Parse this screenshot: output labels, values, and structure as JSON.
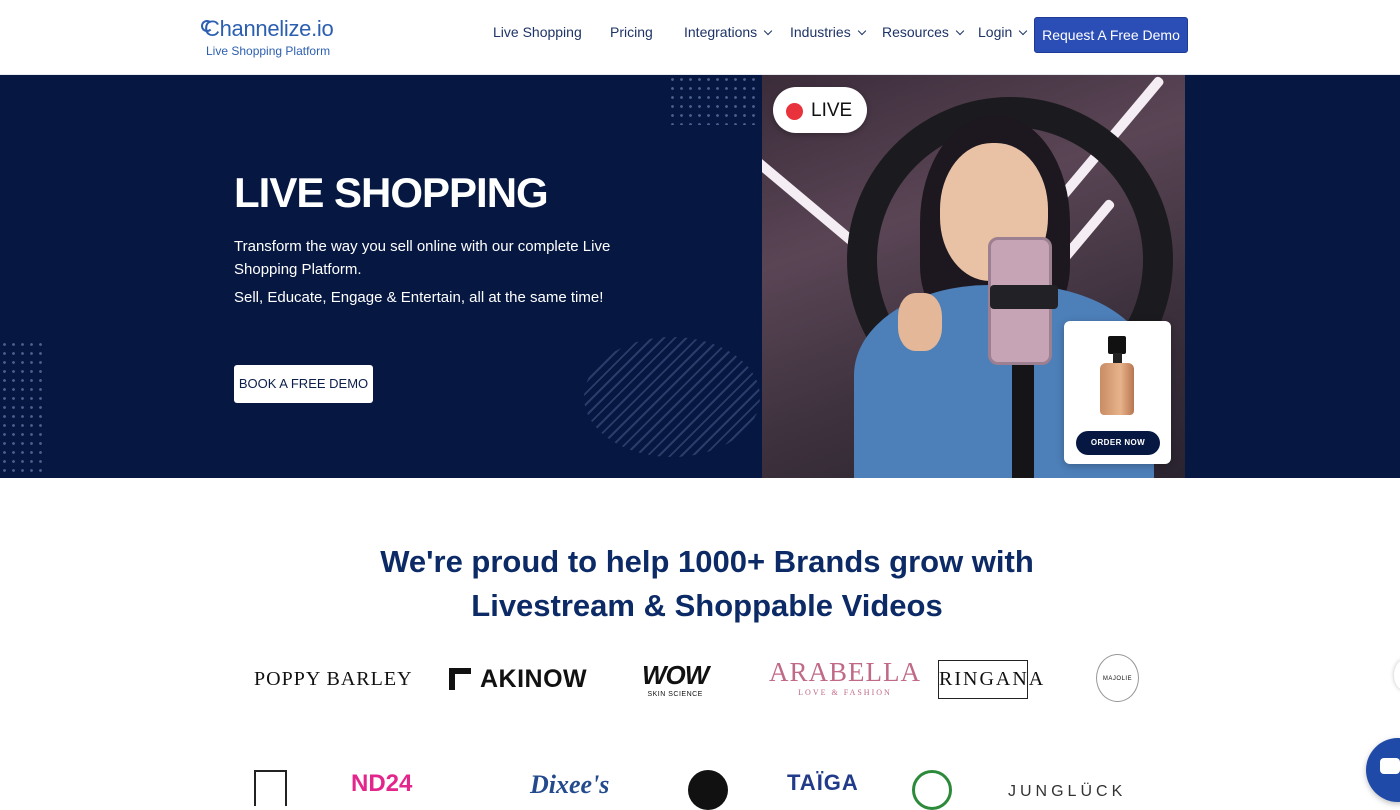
{
  "logo": {
    "name": "Channelize.io",
    "tagline": "Live Shopping Platform"
  },
  "nav": {
    "items": [
      {
        "label": "Live Shopping",
        "has_dropdown": false
      },
      {
        "label": "Pricing",
        "has_dropdown": false
      },
      {
        "label": "Integrations",
        "has_dropdown": true
      },
      {
        "label": "Industries",
        "has_dropdown": true
      },
      {
        "label": "Resources",
        "has_dropdown": true
      },
      {
        "label": "Login",
        "has_dropdown": true
      }
    ],
    "cta_label": "Request A Free Demo"
  },
  "hero": {
    "title": "LIVE SHOPPING",
    "text1": "Transform the way you sell online with our complete Live Shopping Platform.",
    "text2": "Sell, Educate, Engage & Entertain, all at the same time!",
    "cta_label": "BOOK A FREE DEMO",
    "live_badge": "LIVE",
    "product_cta": "ORDER NOW"
  },
  "brands": {
    "title": "We're proud to help 1000+ Brands grow with Livestream & Shoppable Videos",
    "row1": {
      "poppy": "POPPY BARLEY",
      "akinow": "AKINOW",
      "wow_main": "WOW",
      "wow_sub": "SKIN SCIENCE",
      "arabella_main": "ARABELLA",
      "arabella_sub": "LOVE & FASHION",
      "ringana": "RINGANA",
      "majolie": "MAJOLIE"
    },
    "row2": {
      "pink": "ND24",
      "dixee": "Dixee's",
      "taiga": "TAÏGA",
      "junglueck": "JUNGLÜCK"
    }
  },
  "colors": {
    "hero_bg": "#061842",
    "primary_button": "#2a4db6",
    "heading": "#0c2a66",
    "live_dot": "#e8323c"
  },
  "icons": [
    "chevron-down-icon",
    "live-dot-icon",
    "chat-icon"
  ]
}
